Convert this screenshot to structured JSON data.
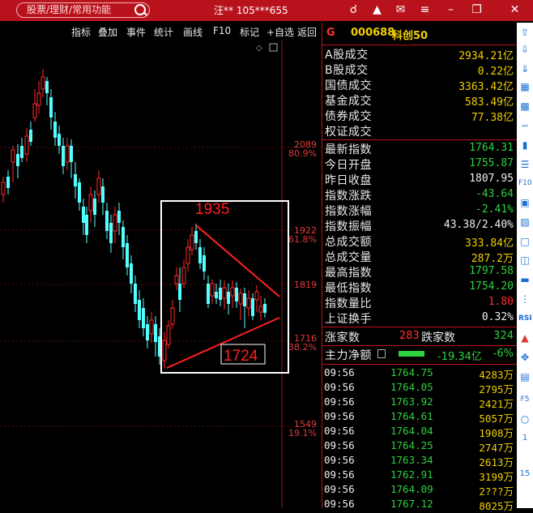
{
  "titlebar": {
    "search_placeholder": "股票/理财/常用功能",
    "user": "汪** 105***655",
    "icons": [
      "headset-icon",
      "tshirt-icon",
      "mail-icon",
      "menu-icon",
      "minimize-icon",
      "restore-icon",
      "close-icon"
    ]
  },
  "toolbar": {
    "items": [
      "指标",
      "叠加",
      "事件",
      "统计",
      "画线",
      "F10",
      "标记",
      "+自选",
      "返回"
    ]
  },
  "chart": {
    "price_labels": [
      {
        "price": "2089",
        "pct": "80.9%"
      },
      {
        "price": "1922",
        "pct": "61.8%"
      },
      {
        "price": "1819",
        "pct": ""
      },
      {
        "price": "1716",
        "pct": "38.2%"
      },
      {
        "price": "1549",
        "pct": "19.1%"
      }
    ],
    "annotation_high": "1935",
    "annotation_low": "1724",
    "colors": {
      "up": "#ff2a2a",
      "down": "#54ffff",
      "box": "#ffffff",
      "trend": "#ff2020"
    }
  },
  "panel": {
    "flag": "G",
    "code": "000688",
    "name": "科创50",
    "volumes": [
      {
        "label": "A股成交",
        "value": "2934.21亿"
      },
      {
        "label": "B股成交",
        "value": "0.22亿"
      },
      {
        "label": "国债成交",
        "value": "3363.42亿"
      },
      {
        "label": "基金成交",
        "value": "583.49亿"
      },
      {
        "label": "债券成交",
        "value": "77.38亿"
      },
      {
        "label": "权证成交",
        "value": ""
      }
    ],
    "stats": [
      {
        "label": "最新指数",
        "value": "1764.31",
        "color": "#2fd13f"
      },
      {
        "label": "今日开盘",
        "value": "1755.87",
        "color": "#2fd13f"
      },
      {
        "label": "昨日收盘",
        "value": "1807.95",
        "color": "#eeeeee"
      },
      {
        "label": "指数涨跌",
        "value": "-43.64",
        "color": "#2fd13f"
      },
      {
        "label": "指数涨幅",
        "value": "-2.41%",
        "color": "#2fd13f"
      },
      {
        "label": "指数振幅",
        "value": "43.38/2.40%",
        "color": "#eeeeee"
      },
      {
        "label": "总成交额",
        "value": "333.84亿",
        "color": "#f0d000"
      },
      {
        "label": "总成交量",
        "value": "287.2万",
        "color": "#f0d000"
      },
      {
        "label": "最高指数",
        "value": "1797.58",
        "color": "#2fd13f"
      },
      {
        "label": "最低指数",
        "value": "1754.20",
        "color": "#2fd13f"
      },
      {
        "label": "指数量比",
        "value": "1.80",
        "color": "#ff3030"
      },
      {
        "label": "上证换手",
        "value": "0.32%",
        "color": "#eeeeee"
      }
    ],
    "breadth": {
      "up_label": "涨家数",
      "up_value": "283",
      "down_label": "跌家数",
      "down_value": "324"
    },
    "main_flow": {
      "label": "主力净额",
      "value": "-19.34亿",
      "pct": "-6%"
    },
    "ticks": [
      {
        "time": "09:56",
        "price": "1764.75",
        "vol": "4283万"
      },
      {
        "time": "09:56",
        "price": "1764.05",
        "vol": "2795万"
      },
      {
        "time": "09:56",
        "price": "1763.92",
        "vol": "2421万"
      },
      {
        "time": "09:56",
        "price": "1764.61",
        "vol": "5057万"
      },
      {
        "time": "09:56",
        "price": "1764.04",
        "vol": "1908万"
      },
      {
        "time": "09:56",
        "price": "1764.25",
        "vol": "2747万"
      },
      {
        "time": "09:56",
        "price": "1763.34",
        "vol": "2613万"
      },
      {
        "time": "09:56",
        "price": "1762.91",
        "vol": "3199万"
      },
      {
        "time": "09:56",
        "price": "1764.09",
        "vol": "2???万"
      },
      {
        "time": "09:56",
        "price": "1767.12",
        "vol": "8025万"
      }
    ]
  },
  "right_toolbar": {
    "labels": [
      "F10",
      "RSI",
      "F5",
      "1",
      "15"
    ]
  }
}
